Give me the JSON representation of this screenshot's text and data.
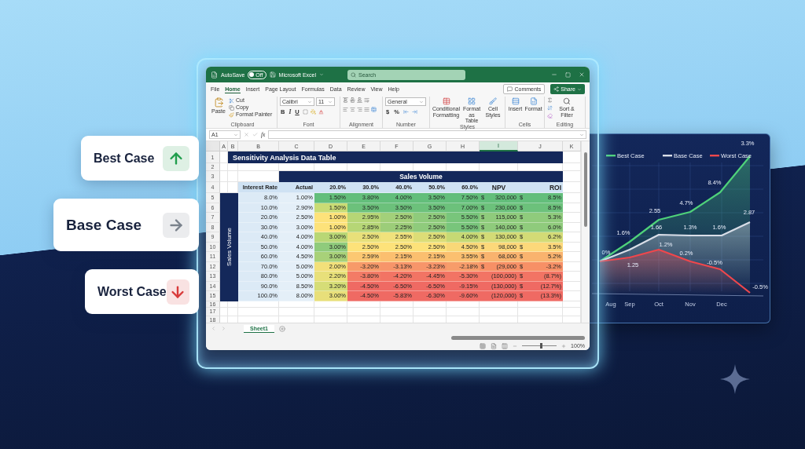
{
  "cards": [
    {
      "label": "Best Case",
      "kind": "up",
      "color": "#1f9d4c"
    },
    {
      "label": "Base Case",
      "kind": "right",
      "color": "#7a828c"
    },
    {
      "label": "Worst Case",
      "kind": "down",
      "color": "#d83a3a"
    }
  ],
  "window": {
    "autosave_label": "AutoSave",
    "autosave_toggle": "Off",
    "autosave_on": false,
    "title": "Microsoft Excel",
    "search": {
      "placeholder": "Search"
    }
  },
  "ribbon_tabs": [
    {
      "label": "File",
      "selected": false
    },
    {
      "label": "Home",
      "selected": true
    },
    {
      "label": "Insert",
      "selected": false
    },
    {
      "label": "Page Layout",
      "selected": false
    },
    {
      "label": "Formulas",
      "selected": false
    },
    {
      "label": "Data",
      "selected": false
    },
    {
      "label": "Review",
      "selected": false
    },
    {
      "label": "View",
      "selected": false
    },
    {
      "label": "Help",
      "selected": false
    }
  ],
  "comments_button": "Comments",
  "share_button": "Share",
  "ribbon_groups": [
    {
      "kind": "clipboard",
      "label": "Clipboard",
      "main": "Paste",
      "items": [
        "Cut",
        "Copy",
        "Format Painter"
      ]
    },
    {
      "kind": "font",
      "label": "Font",
      "font_name": "Calibri",
      "font_size": "11",
      "styles": [
        "B",
        "I",
        "U"
      ]
    },
    {
      "kind": "alignment",
      "label": "Alignment"
    },
    {
      "kind": "number",
      "label": "Number",
      "format": "General",
      "symbols": [
        "$",
        "%"
      ]
    },
    {
      "kind": "styles",
      "label": "Styles",
      "items": [
        "Conditional Formatting",
        "Format as Table",
        "Cell Styles"
      ]
    },
    {
      "kind": "cells",
      "label": "Cells",
      "items": [
        "Insert",
        "Format"
      ]
    },
    {
      "kind": "editing",
      "label": "Editing",
      "items": [
        "Sort & Filter"
      ]
    }
  ],
  "formula_bar": {
    "name_box": "A1",
    "function_label": "fx"
  },
  "sheet": {
    "column_headers": [
      {
        "label": "A",
        "selected": false
      },
      {
        "label": "B",
        "selected": false
      },
      {
        "label": "B",
        "selected": false
      },
      {
        "label": "C",
        "selected": false
      },
      {
        "label": "D",
        "selected": false
      },
      {
        "label": "E",
        "selected": false
      },
      {
        "label": "F",
        "selected": false
      },
      {
        "label": "G",
        "selected": false
      },
      {
        "label": "H",
        "selected": false
      },
      {
        "label": "I",
        "selected": true
      },
      {
        "label": "J",
        "selected": false
      },
      {
        "label": "K",
        "selected": false
      }
    ],
    "row_numbers": [
      "1",
      "2",
      "3",
      "4",
      "5",
      "6",
      "7",
      "8",
      "9",
      "10",
      "11",
      "12",
      "13",
      "14",
      "15",
      "16",
      "17",
      "18"
    ],
    "title": "Sensitivity Analysis Data Table",
    "band": "Sales Volume",
    "side_label": "Sales Volume",
    "headers": [
      "Interest Rate",
      "Actual",
      "20.0%",
      "30.0%",
      "40.0%",
      "50.0%",
      "60.0%",
      "NPV",
      "ROI"
    ],
    "rows": [
      {
        "rate": "8.0%",
        "actual": "1.00%",
        "cells": [
          {
            "text": "1.50%",
            "color": "#63be7b"
          },
          {
            "text": "3.80%",
            "color": "#63be7b"
          },
          {
            "text": "4.00%",
            "color": "#63be7b"
          },
          {
            "text": "3.50%",
            "color": "#63be7b"
          },
          {
            "text": "7.50%",
            "color": "#63be7b"
          }
        ],
        "npv_sign": "$",
        "npv": "320,000",
        "roi_sign": "$",
        "roi": "8.5%",
        "color": "#63be7b"
      },
      {
        "rate": "10.0%",
        "actual": "2.90%",
        "cells": [
          {
            "text": "1.50%",
            "color": "#c9dc75"
          },
          {
            "text": "3.50%",
            "color": "#6cc17b"
          },
          {
            "text": "3.50%",
            "color": "#6cc17b"
          },
          {
            "text": "3.50%",
            "color": "#6cc17b"
          },
          {
            "text": "7.00%",
            "color": "#6cc17b"
          }
        ],
        "npv_sign": "$",
        "npv": "230,000",
        "roi_sign": "$",
        "roi": "8.5%",
        "color": "#6cc17b"
      },
      {
        "rate": "20.0%",
        "actual": "2.50%",
        "cells": [
          {
            "text": "1.00%",
            "color": "#fde27a"
          },
          {
            "text": "2.95%",
            "color": "#b6d676"
          },
          {
            "text": "2.50%",
            "color": "#a3d07a"
          },
          {
            "text": "2.50%",
            "color": "#8fcb7c"
          },
          {
            "text": "5.50%",
            "color": "#78c57b"
          }
        ],
        "npv_sign": "$",
        "npv": "115,000",
        "roi_sign": "$",
        "roi": "5.3%",
        "color": "#8fcb7c"
      },
      {
        "rate": "30.0%",
        "actual": "3.00%",
        "cells": [
          {
            "text": "1.00%",
            "color": "#fde27a"
          },
          {
            "text": "2.85%",
            "color": "#b6d676"
          },
          {
            "text": "2.25%",
            "color": "#9ccd79"
          },
          {
            "text": "2.50%",
            "color": "#8fcb7c"
          },
          {
            "text": "5.50%",
            "color": "#78c57b"
          }
        ],
        "npv_sign": "$",
        "npv": "140,000",
        "roi_sign": "$",
        "roi": "6.0%",
        "color": "#8fcb7c"
      },
      {
        "rate": "40.0%",
        "actual": "4.00%",
        "cells": [
          {
            "text": "3.00%",
            "color": "#b9d775"
          },
          {
            "text": "2.50%",
            "color": "#e8e07a"
          },
          {
            "text": "2.55%",
            "color": "#f0e27c"
          },
          {
            "text": "2.50%",
            "color": "#dcdd77"
          },
          {
            "text": "4.00%",
            "color": "#c6d974"
          }
        ],
        "npv_sign": "$",
        "npv": "130,000",
        "roi_sign": "$",
        "roi": "6.2%",
        "color": "#d3db76"
      },
      {
        "rate": "50.0%",
        "actual": "4.00%",
        "cells": [
          {
            "text": "3.00%",
            "color": "#8fcb7c"
          },
          {
            "text": "2.50%",
            "color": "#fde27a"
          },
          {
            "text": "2.50%",
            "color": "#fde27a"
          },
          {
            "text": "2.50%",
            "color": "#fde27a"
          },
          {
            "text": "4.50%",
            "color": "#f8d878"
          }
        ],
        "npv_sign": "$",
        "npv": "98,000",
        "roi_sign": "$",
        "roi": "3.5%",
        "color": "#fcd87a"
      },
      {
        "rate": "60.0%",
        "actual": "4.50%",
        "cells": [
          {
            "text": "3.00%",
            "color": "#a8d179"
          },
          {
            "text": "2.59%",
            "color": "#fcc872"
          },
          {
            "text": "2.15%",
            "color": "#fbbf6f"
          },
          {
            "text": "2.15%",
            "color": "#fbbf6f"
          },
          {
            "text": "3.55%",
            "color": "#fbc070"
          }
        ],
        "npv_sign": "$",
        "npv": "68,000",
        "roi_sign": "$",
        "roi": "5.2%",
        "color": "#f9b36e"
      },
      {
        "rate": "70.0%",
        "actual": "5.00%",
        "cells": [
          {
            "text": "2.00%",
            "color": "#f2e07a"
          },
          {
            "text": "-3.20%",
            "color": "#f79a69"
          },
          {
            "text": "-3.13%",
            "color": "#f7956a"
          },
          {
            "text": "-3.23%",
            "color": "#f7956a"
          },
          {
            "text": "-2.18%",
            "color": "#f79c6a"
          }
        ],
        "npv_sign": "$",
        "npv": "(29,000",
        "roi_sign": "$",
        "roi": "-3.2%",
        "color": "#f79066"
      },
      {
        "rate": "80.0%",
        "actual": "5.00%",
        "cells": [
          {
            "text": "2.20%",
            "color": "#e8e07a"
          },
          {
            "text": "-3.80%",
            "color": "#f37b66"
          },
          {
            "text": "-4.20%",
            "color": "#f27464"
          },
          {
            "text": "-4.45%",
            "color": "#f27464"
          },
          {
            "text": "-5.30%",
            "color": "#f27464"
          }
        ],
        "npv": "(100,000)",
        "roi_sign": "$",
        "roi": "(8.7%)",
        "color": "#f27464"
      },
      {
        "rate": "90.0%",
        "actual": "8.50%",
        "cells": [
          {
            "text": "3.20%",
            "color": "#d6dd77"
          },
          {
            "text": "-4.50%",
            "color": "#ef6a63"
          },
          {
            "text": "-6.50%",
            "color": "#ef6a63"
          },
          {
            "text": "-6.50%",
            "color": "#ef6a63"
          },
          {
            "text": "-9.15%",
            "color": "#ef6a63"
          }
        ],
        "npv": "(130,000)",
        "roi_sign": "$",
        "roi": "(12.7%)",
        "color": "#ef6a63"
      },
      {
        "rate": "100.0%",
        "actual": "8.00%",
        "cells": [
          {
            "text": "3.00%",
            "color": "#e8df7a"
          },
          {
            "text": "-4.50%",
            "color": "#ef6a63"
          },
          {
            "text": "-5.83%",
            "color": "#ef6a63"
          },
          {
            "text": "-6.30%",
            "color": "#ef6a63"
          },
          {
            "text": "-9.60%",
            "color": "#ef6a63"
          }
        ],
        "npv": "(120,000)",
        "roi_sign": "$",
        "roi": "(13.3%)",
        "color": "#ef6a63"
      }
    ]
  },
  "sheet_tabs": [
    {
      "label": "Sheet1",
      "selected": true
    }
  ],
  "status_bar": {
    "zoom": {
      "label": "100%",
      "level": 0.55
    }
  },
  "chart": {
    "series": [
      {
        "name": "Best Case",
        "color": "#4fd27a",
        "labels": [
          "1.6%",
          "2.55",
          "4.7%",
          "8.4%",
          "3.3%"
        ]
      },
      {
        "name": "Base Case",
        "color": "#d9dee8",
        "labels": [
          "1.25",
          "1.66",
          "1.3%",
          "1.6%",
          "2.87"
        ]
      },
      {
        "name": "Worst Case",
        "color": "#f0474c",
        "labels": [
          "0%",
          "1.2%",
          "0.2%",
          "-0.5%",
          "-0.5%"
        ]
      }
    ],
    "months": [
      "Aug",
      "Sep",
      "Oct",
      "Nov",
      "Dec"
    ]
  }
}
